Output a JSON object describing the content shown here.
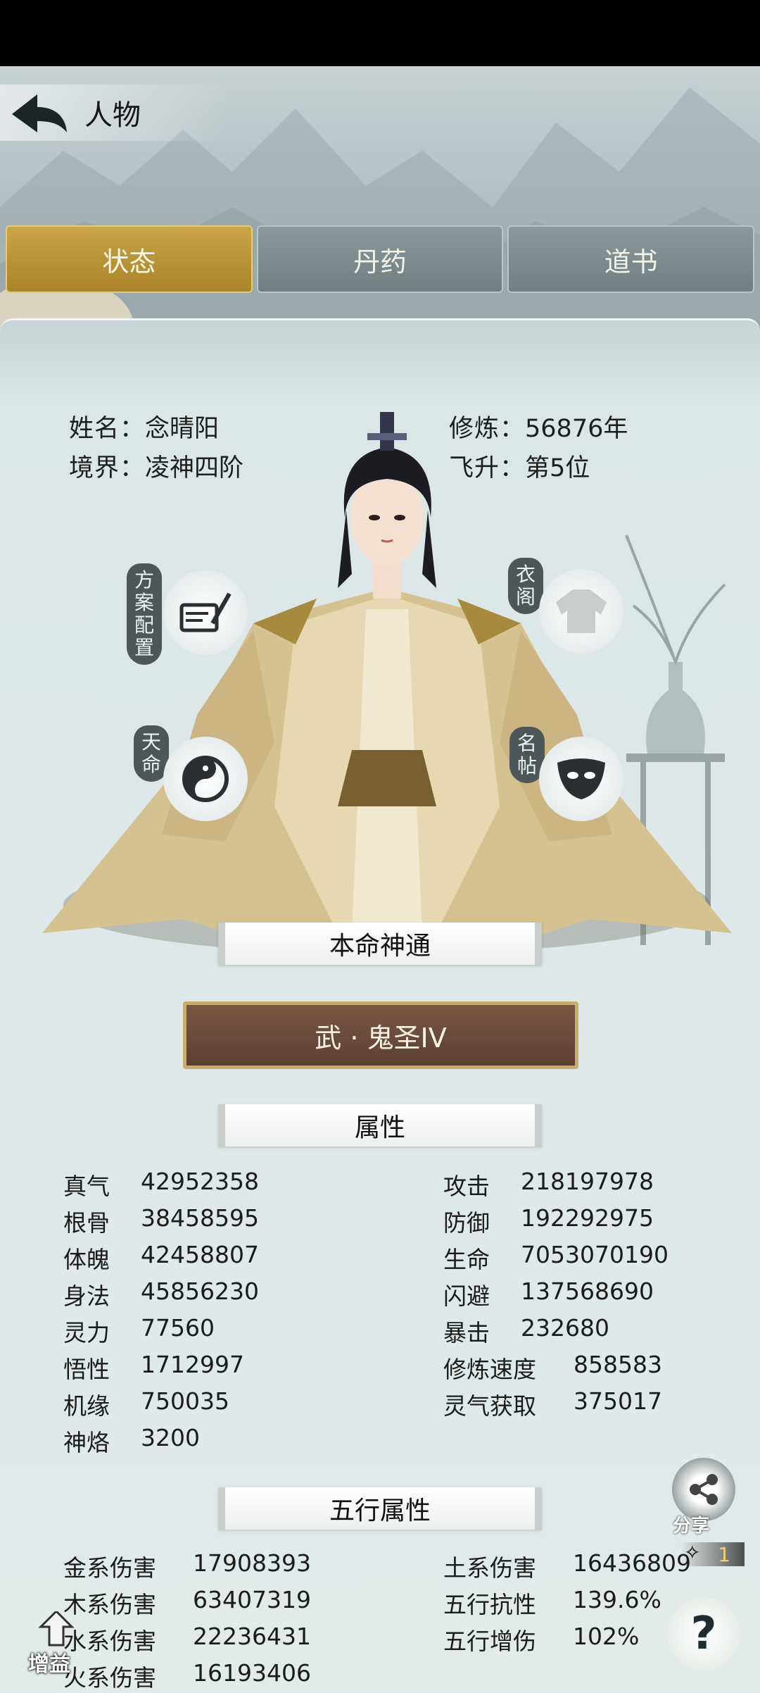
{
  "header": {
    "title": "人物"
  },
  "tabs": [
    {
      "label": "状态",
      "active": true
    },
    {
      "label": "丹药",
      "active": false
    },
    {
      "label": "道书",
      "active": false
    }
  ],
  "profile": {
    "name_label": "姓名：",
    "name_value": "念晴阳",
    "realm_label": "境界：",
    "realm_value": "凌神四阶",
    "cultivation_label": "修炼：",
    "cultivation_value": "56876年",
    "ascension_label": "飞升：",
    "ascension_value": "第5位"
  },
  "side_buttons": {
    "plan": "方案配置",
    "wardrobe": "衣阁",
    "fate": "天命",
    "card": "名帖"
  },
  "innate_skill": {
    "title": "本命神通",
    "value": "武 · 鬼圣IV"
  },
  "attributes": {
    "title": "属性",
    "left": [
      {
        "label": "真气",
        "value": "42952358"
      },
      {
        "label": "根骨",
        "value": "38458595"
      },
      {
        "label": "体魄",
        "value": "42458807"
      },
      {
        "label": "身法",
        "value": "45856230"
      },
      {
        "label": "灵力",
        "value": "77560"
      },
      {
        "label": "悟性",
        "value": "1712997"
      },
      {
        "label": "机缘",
        "value": "750035"
      },
      {
        "label": "神烙",
        "value": "3200"
      }
    ],
    "right": [
      {
        "label": "攻击",
        "value": "218197978"
      },
      {
        "label": "防御",
        "value": "192292975"
      },
      {
        "label": "生命",
        "value": "7053070190"
      },
      {
        "label": "闪避",
        "value": "137568690"
      },
      {
        "label": "暴击",
        "value": "232680"
      },
      {
        "label": "修炼速度",
        "value": "858583"
      },
      {
        "label": "灵气获取",
        "value": "375017"
      }
    ]
  },
  "elements": {
    "title": "五行属性",
    "left": [
      {
        "label": "金系伤害",
        "value": "17908393"
      },
      {
        "label": "木系伤害",
        "value": "63407319"
      },
      {
        "label": "水系伤害",
        "value": "22236431"
      },
      {
        "label": "火系伤害",
        "value": "16193406"
      }
    ],
    "right": [
      {
        "label": "土系伤害",
        "value": "16436809"
      },
      {
        "label": "五行抗性",
        "value": "139.6%"
      },
      {
        "label": "五行增伤",
        "value": "102%"
      }
    ]
  },
  "floating": {
    "share": "分享",
    "boost": "增益",
    "help": "?",
    "badge": "1"
  }
}
